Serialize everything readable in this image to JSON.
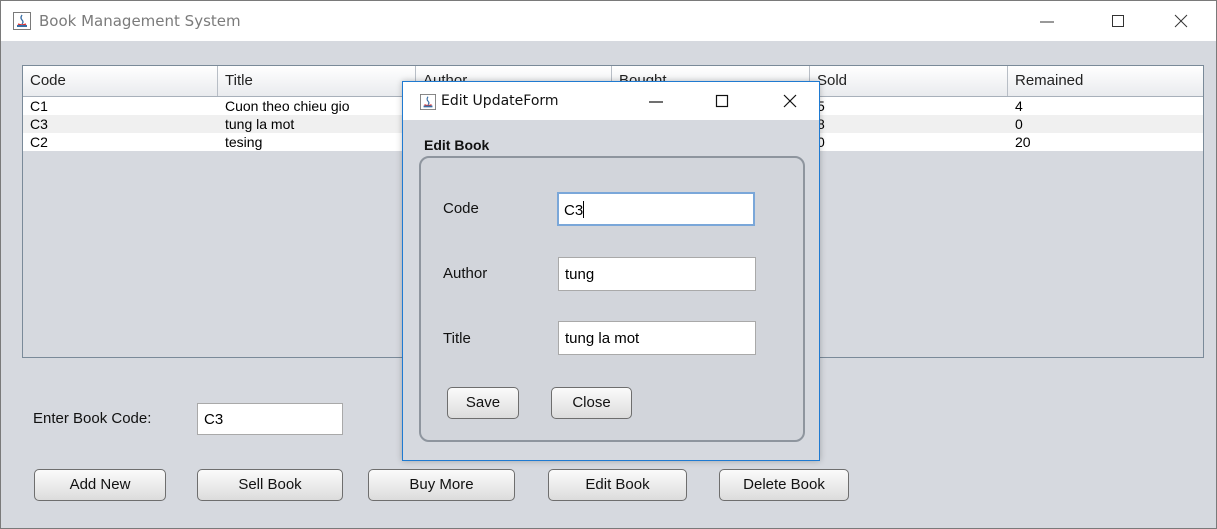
{
  "window": {
    "title": "Book Management System",
    "controls": {
      "minimize": "minimize-icon",
      "maximize": "maximize-icon",
      "close": "close-icon"
    }
  },
  "table": {
    "columns": [
      "Code",
      "Title",
      "Author",
      "Bought",
      "Sold",
      "Remained"
    ],
    "rows": [
      [
        "C1",
        "Cuon theo chieu gio",
        "",
        "",
        "5",
        "4"
      ],
      [
        "C3",
        "tung la mot",
        "",
        "",
        "8",
        "0"
      ],
      [
        "C2",
        "tesing",
        "",
        "",
        "0",
        "20"
      ]
    ]
  },
  "bottom": {
    "code_label": "Enter Book Code:",
    "code_value": "C3",
    "buttons": {
      "add": "Add New",
      "sell": "Sell Book",
      "buy": "Buy More",
      "edit": "Edit Book",
      "delete": "Delete Book"
    }
  },
  "dialog": {
    "title": "Edit UpdateForm",
    "section": "Edit Book",
    "fields": {
      "code_label": "Code",
      "code_value": "C3",
      "author_label": "Author",
      "author_value": "tung",
      "title_label": "Title",
      "title_value": "tung la mot"
    },
    "buttons": {
      "save": "Save",
      "close": "Close"
    }
  },
  "colors": {
    "accent": "#1f7ad1",
    "background": "#d6d9df"
  }
}
